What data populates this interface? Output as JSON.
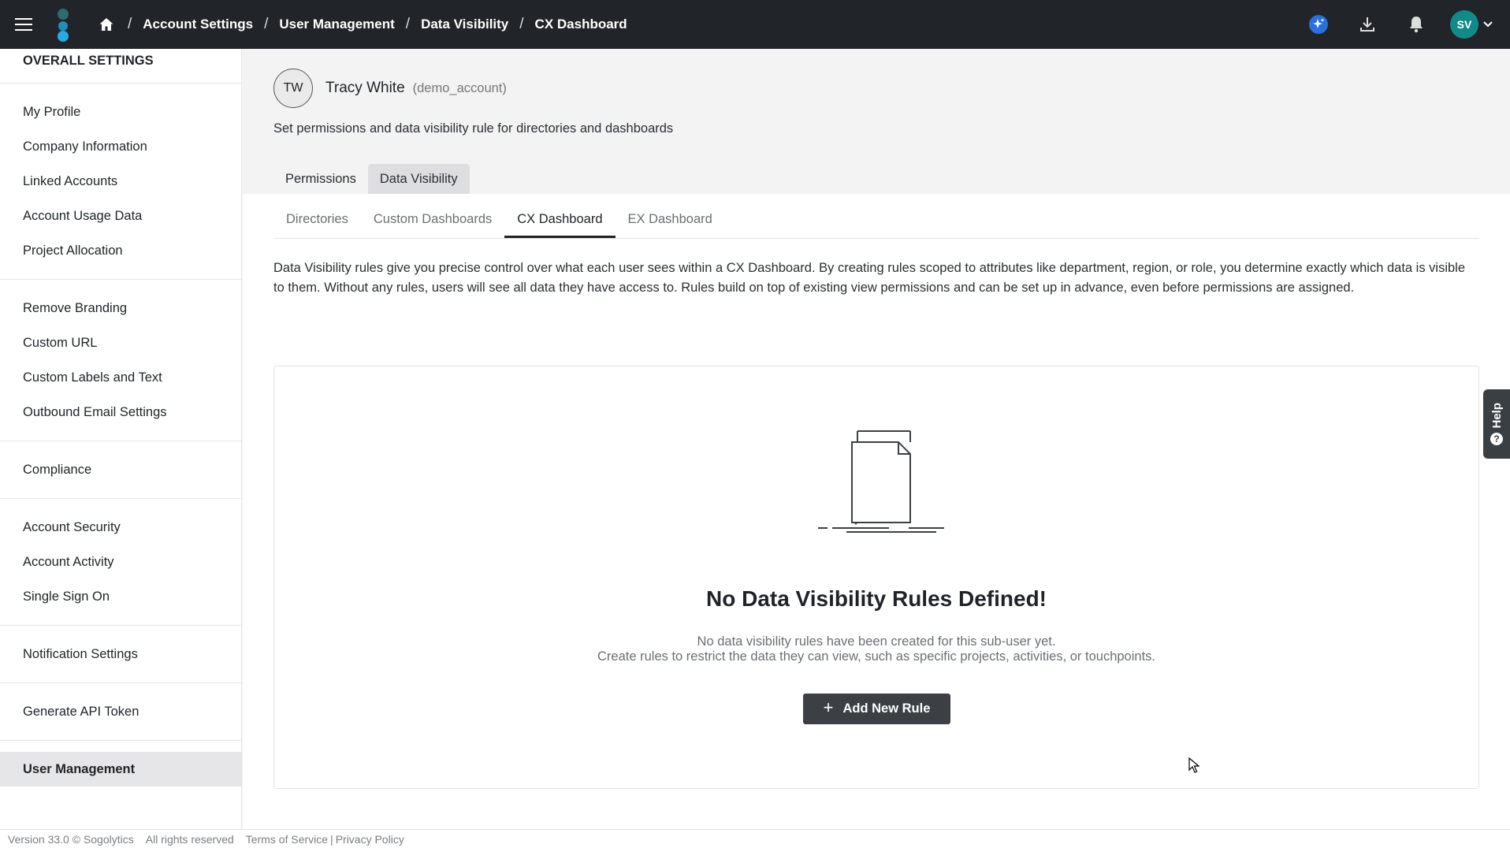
{
  "header": {
    "breadcrumbs": [
      "Account Settings",
      "User Management",
      "Data Visibility",
      "CX Dashboard"
    ],
    "separator": "/",
    "avatar_initials": "SV"
  },
  "sidebar": {
    "title": "OVERALL SETTINGS",
    "groups": [
      [
        "My Profile",
        "Company Information",
        "Linked Accounts",
        "Account Usage Data",
        "Project Allocation"
      ],
      [
        "Remove Branding",
        "Custom URL",
        "Custom Labels and Text",
        "Outbound Email Settings"
      ],
      [
        "Compliance"
      ],
      [
        "Account Security",
        "Account Activity",
        "Single Sign On"
      ],
      [
        "Notification Settings"
      ],
      [
        "Generate API Token"
      ],
      [
        "User Management"
      ]
    ]
  },
  "user": {
    "initials": "TW",
    "name": "Tracy White",
    "handle": "(demo_account)",
    "description": "Set permissions and data visibility rule for directories and dashboards"
  },
  "main_tabs": [
    "Permissions",
    "Data Visibility"
  ],
  "sub_tabs": [
    "Directories",
    "Custom Dashboards",
    "CX Dashboard",
    "EX Dashboard"
  ],
  "rules_description": "Data Visibility rules give you precise control over what each user sees within a CX Dashboard. By creating rules scoped to attributes like department, region, or role, you determine exactly which data is visible to them. Without any rules, users will see all data they have access to. Rules build on top of existing view permissions and can be set up in advance, even before permissions are assigned.",
  "empty_state": {
    "title": "No Data Visibility Rules Defined!",
    "line1": "No data visibility rules have been created for this sub-user yet.",
    "line2": "Create rules to restrict the data they can view, such as specific projects, activities, or touchpoints.",
    "button_label": "Add New Rule",
    "button_icon": "+"
  },
  "help": {
    "label": "Help",
    "icon": "?"
  },
  "footer": {
    "version": "Version 33.0 © Sogolytics",
    "rights": "All rights reserved",
    "terms": "Terms of Service",
    "divider": "|",
    "privacy": "Privacy Policy"
  },
  "colors": {
    "topbar": "#212529",
    "accent_teal": "#138a8a",
    "button": "#3c4045"
  }
}
